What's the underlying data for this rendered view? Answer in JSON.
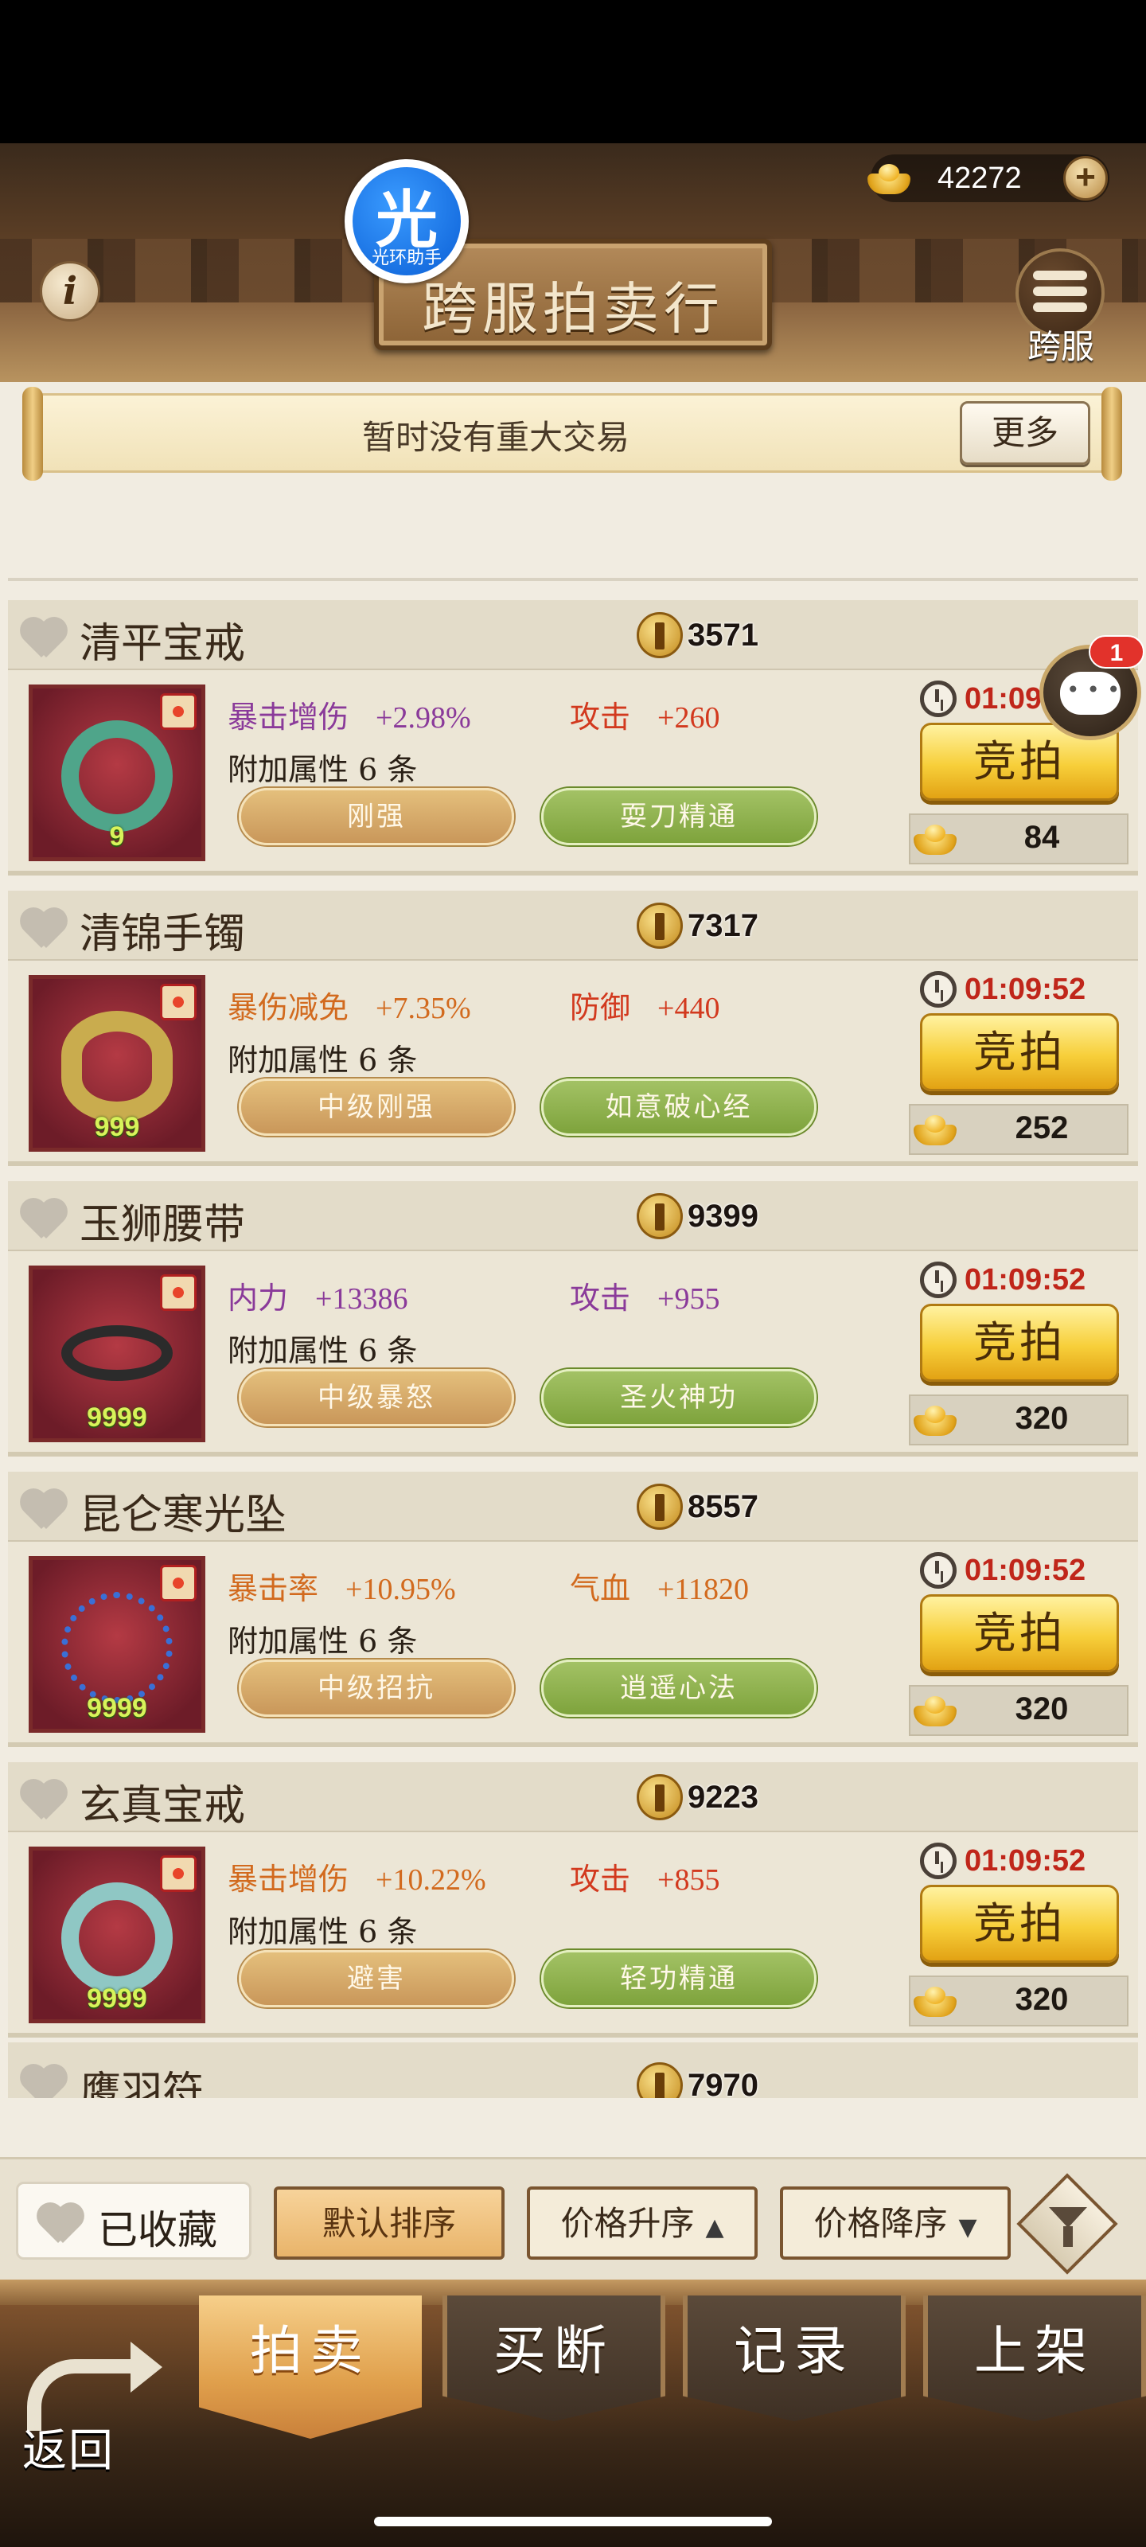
{
  "header": {
    "title": "跨服拍卖行",
    "currency": {
      "icon": "gold-ingot-icon",
      "value": "42272"
    },
    "cross_server_label": "跨服",
    "badge": {
      "glyph": "光",
      "label": "光环助手"
    }
  },
  "notice": {
    "message": "暂时没有重大交易",
    "more_label": "更多"
  },
  "chat": {
    "unread": "1"
  },
  "extra_attr_label": "附加属性 6 条",
  "bid_label": "竞拍",
  "items": [
    {
      "name": "清平宝戒",
      "power": "3571",
      "level": "9",
      "stat1": {
        "key": "暴击增伤",
        "value": "+2.98%",
        "color": "#8a3a9a"
      },
      "stat2": {
        "key": "攻击",
        "value": "+260",
        "color": "#d26a1e"
      },
      "tag1": "刚强",
      "tag2": "耍刀精通",
      "timer": "01:09:52",
      "price": "84"
    },
    {
      "name": "清锦手镯",
      "power": "7317",
      "level": "999",
      "stat1": {
        "key": "暴伤减免",
        "value": "+7.35%",
        "color": "#d26a1e"
      },
      "stat2": {
        "key": "防御",
        "value": "+440",
        "color": "#d2391e"
      },
      "tag1": "中级刚强",
      "tag2": "如意破心经",
      "timer": "01:09:52",
      "price": "252"
    },
    {
      "name": "玉狮腰带",
      "power": "9399",
      "level": "9999",
      "stat1": {
        "key": "内力",
        "value": "+13386",
        "color": "#8a3a9a"
      },
      "stat2": {
        "key": "攻击",
        "value": "+955",
        "color": "#8a3a9a"
      },
      "tag1": "中级暴怒",
      "tag2": "圣火神功",
      "timer": "01:09:52",
      "price": "320"
    },
    {
      "name": "昆仑寒光坠",
      "power": "8557",
      "level": "9999",
      "stat1": {
        "key": "暴击率",
        "value": "+10.95%",
        "color": "#d26a1e"
      },
      "stat2": {
        "key": "气血",
        "value": "+11820",
        "color": "#d26a1e"
      },
      "tag1": "中级招抗",
      "tag2": "逍遥心法",
      "timer": "01:09:52",
      "price": "320"
    },
    {
      "name": "玄真宝戒",
      "power": "9223",
      "level": "9999",
      "stat1": {
        "key": "暴击增伤",
        "value": "+10.22%",
        "color": "#d26a1e"
      },
      "stat2": {
        "key": "攻击",
        "value": "+855",
        "color": "#d26a1e"
      },
      "tag1": "避害",
      "tag2": "轻功精通",
      "timer": "01:09:52",
      "price": "320"
    }
  ],
  "partial_item": {
    "name": "鹰羽符",
    "power": "7970"
  },
  "sort_bar": {
    "favorites": "已收藏",
    "default_sort": "默认排序",
    "price_asc": "价格升序",
    "price_desc": "价格降序"
  },
  "nav": {
    "back": "返回",
    "tabs": [
      "拍卖",
      "买断",
      "记录",
      "上架"
    ],
    "active_tab": "拍卖"
  }
}
